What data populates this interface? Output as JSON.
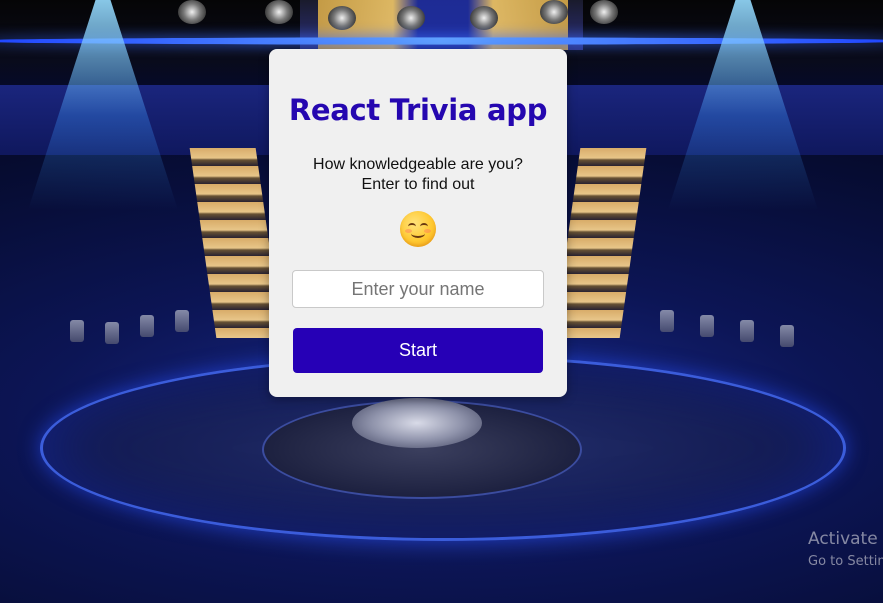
{
  "card": {
    "title": "React Trivia app",
    "subtitle_line1": "How knowledgeable are you?",
    "subtitle_line2": "Enter to find out",
    "emoji_icon": "smiling-face-icon"
  },
  "name_input": {
    "value": "",
    "placeholder": "Enter your name"
  },
  "start_button": {
    "label": "Start"
  },
  "os_watermark": {
    "line1": "Activate Windows",
    "line2": "Go to Settings to activate Windows."
  },
  "colors": {
    "title": "#2507b0",
    "button_bg": "#2600b6",
    "card_bg": "#f0f0f0"
  }
}
